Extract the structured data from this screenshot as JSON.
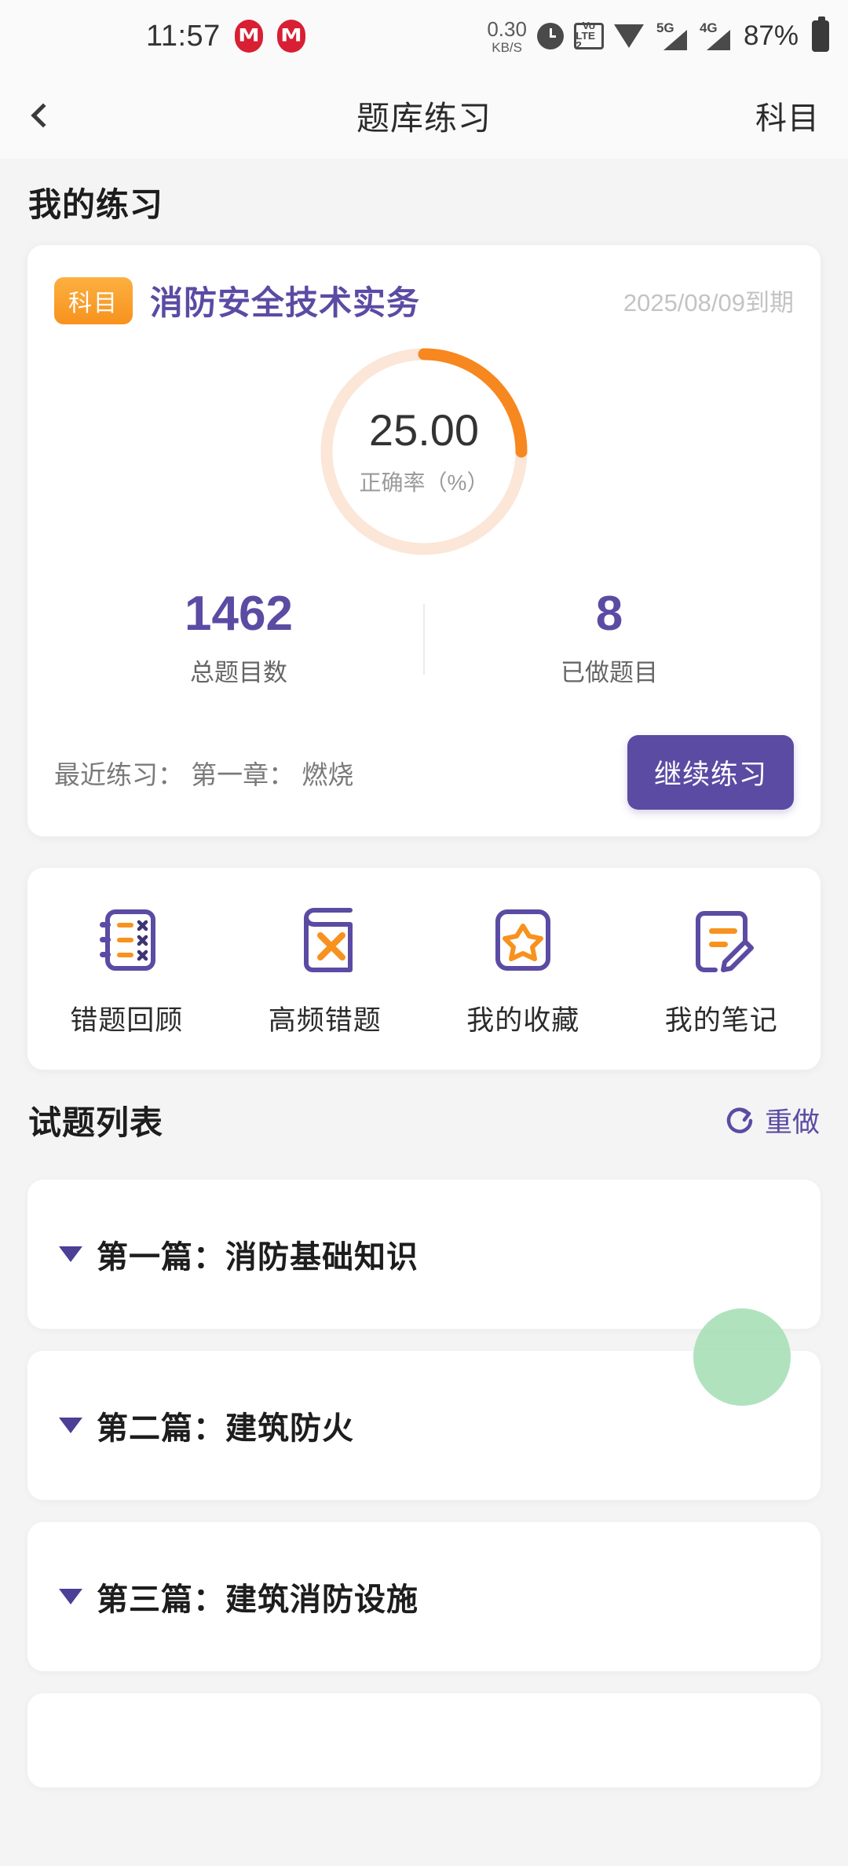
{
  "status_bar": {
    "time": "11:57",
    "app_icon_glyph": "M",
    "app_icon_count": 2,
    "network_speed_value": "0.30",
    "network_speed_unit": "KB/S",
    "alarm_icon": "alarm-clock-icon",
    "volte_line1": "Vo LTE",
    "volte_label_top": "Vo",
    "volte_label_bottom": "LTE 2",
    "wifi_icon": "wifi-icon",
    "signal_1_label": "5G",
    "signal_2_label": "4G",
    "battery_percent": "87%"
  },
  "nav": {
    "back_icon": "chevron-left-icon",
    "title": "题库练习",
    "action_label": "科目"
  },
  "my_practice": {
    "section_title": "我的练习",
    "badge": "科目",
    "subject": "消防安全技术实务",
    "expire": "2025/08/09到期",
    "ring": {
      "value": "25.00",
      "label": "正确率（%）",
      "percent": 25,
      "arc_color": "#f7871f",
      "track_color": "#fbe6d8"
    },
    "stats": [
      {
        "number": "1462",
        "label": "总题目数"
      },
      {
        "number": "8",
        "label": "已做题目"
      }
    ],
    "recent_text": "最近练习： 第一章： 燃烧",
    "continue_button": "继续练习"
  },
  "tools": [
    {
      "label": "错题回顾",
      "icon": "wrong-question-notebook-icon"
    },
    {
      "label": "高频错题",
      "icon": "frequent-error-book-icon"
    },
    {
      "label": "我的收藏",
      "icon": "star-favorite-icon"
    },
    {
      "label": "我的笔记",
      "icon": "note-pencil-icon"
    }
  ],
  "question_list": {
    "section_title": "试题列表",
    "redo_label": "重做",
    "redo_icon": "refresh-icon",
    "chapters": [
      {
        "label": "第一篇：消防基础知识",
        "expand_icon": "triangle-down-icon"
      },
      {
        "label": "第二篇：建筑防火",
        "expand_icon": "triangle-down-icon"
      },
      {
        "label": "第三篇：建筑消防设施",
        "expand_icon": "triangle-down-icon"
      }
    ]
  },
  "colors": {
    "primary_purple": "#5b4ba3",
    "accent_orange": "#f7871f",
    "page_background": "#f4f4f4",
    "touch_indicator": "#a9dfb9"
  }
}
